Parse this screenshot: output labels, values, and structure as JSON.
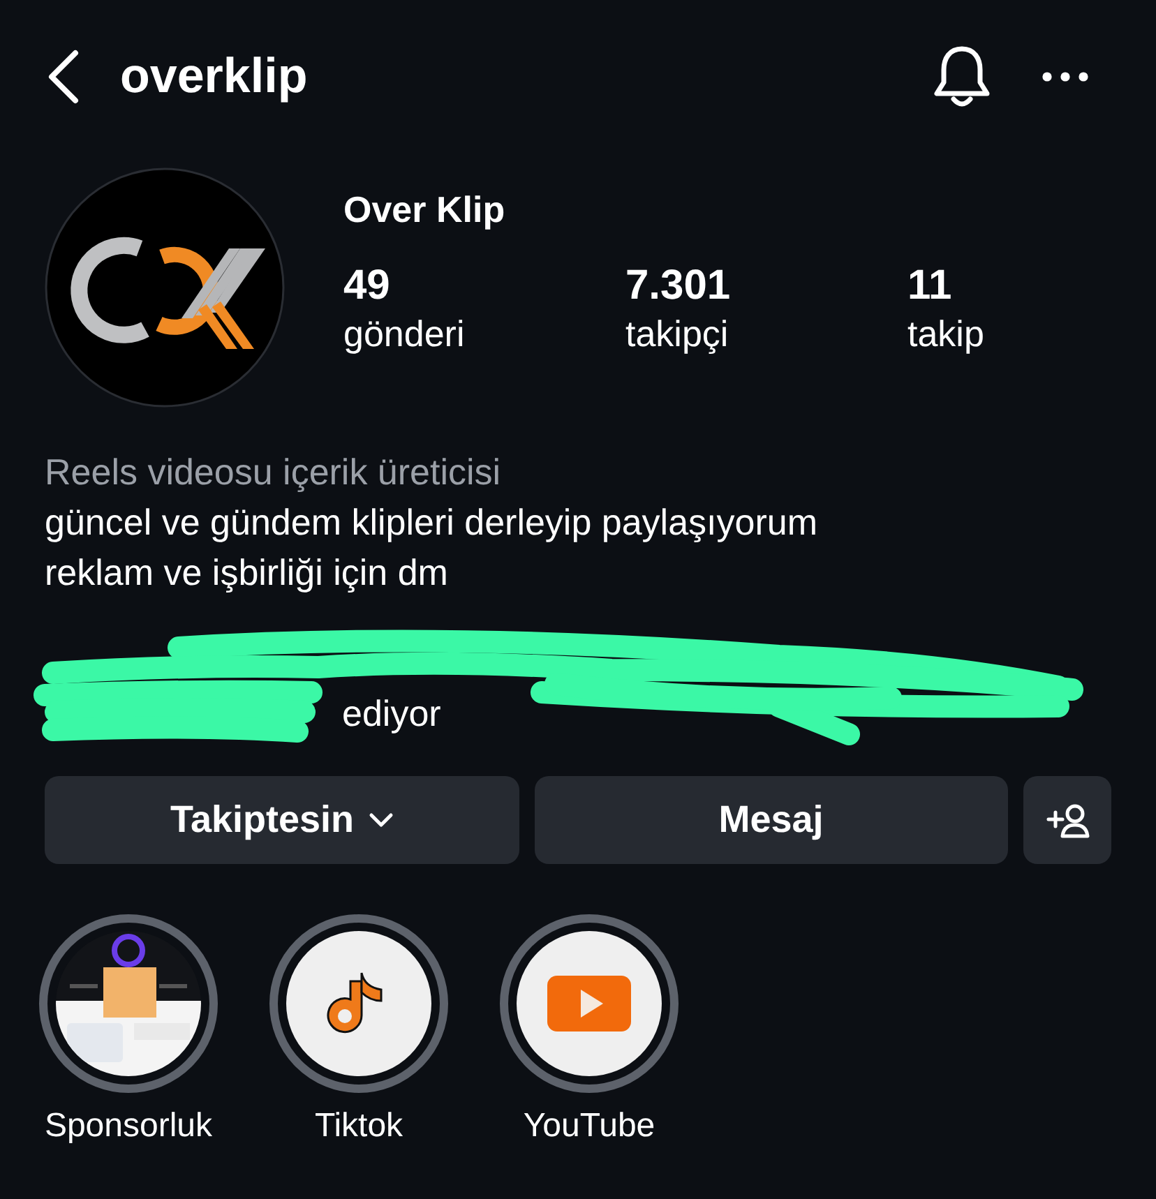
{
  "header": {
    "username": "overklip"
  },
  "profile": {
    "name": "Over Klip",
    "stats": [
      {
        "value": "49",
        "label": "gönderi"
      },
      {
        "value": "7.301",
        "label": "takipçi"
      },
      {
        "value": "11",
        "label": "takip"
      }
    ]
  },
  "bio": {
    "category": "Reels videosu içerik üreticisi",
    "lines": [
      "güncel ve gündem klipleri derleyip paylaşıyorum",
      "reklam ve işbirliği için dm"
    ]
  },
  "followed_by": {
    "text": "ediyor",
    "redacted": true
  },
  "actions": [
    {
      "label": "Takiptesin",
      "kind": "dropdown"
    },
    {
      "label": "Mesaj",
      "kind": "plain"
    },
    {
      "kind": "add-person"
    }
  ],
  "highlights": [
    {
      "label": "Sponsorluk",
      "kind": "picture"
    },
    {
      "label": "Tiktok",
      "kind": "tiktok"
    },
    {
      "label": "YouTube",
      "kind": "youtube"
    }
  ]
}
